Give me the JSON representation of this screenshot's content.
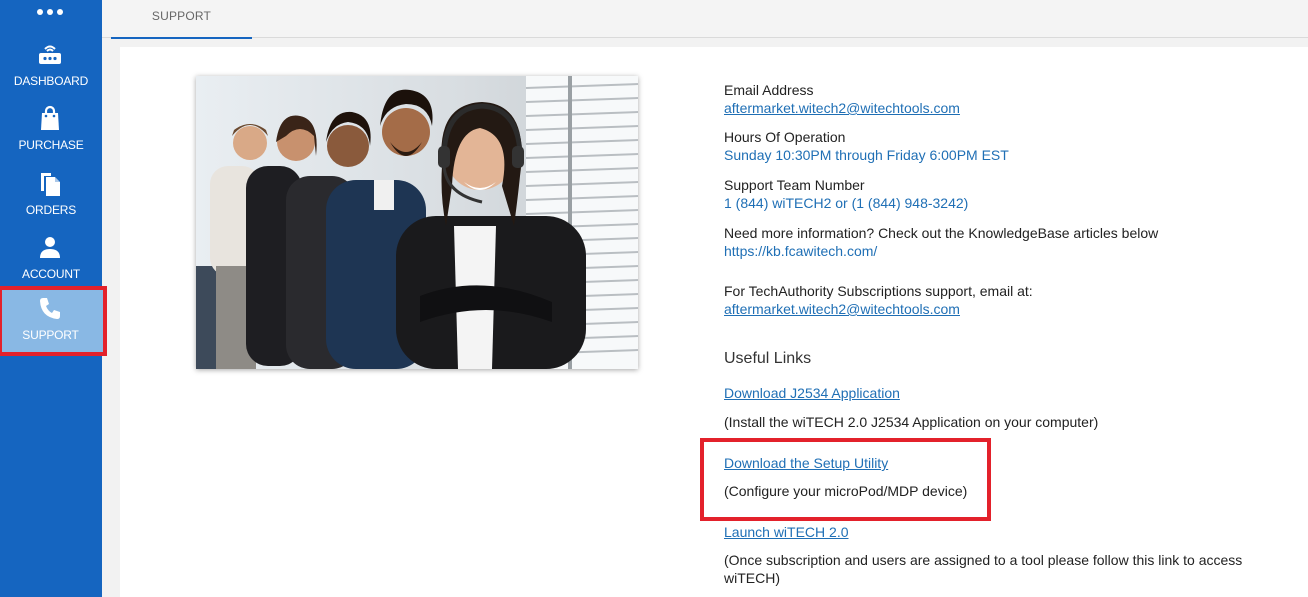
{
  "sidebar": {
    "items": [
      {
        "label": "DASHBOARD",
        "icon": "dashboard-icon"
      },
      {
        "label": "PURCHASE",
        "icon": "shopping-bag-icon"
      },
      {
        "label": "ORDERS",
        "icon": "documents-icon"
      },
      {
        "label": "ACCOUNT",
        "icon": "person-icon"
      },
      {
        "label": "SUPPORT",
        "icon": "phone-icon"
      }
    ],
    "active": "SUPPORT"
  },
  "tabs": [
    {
      "label": "SUPPORT"
    }
  ],
  "support": {
    "email_label": "Email Address",
    "email_value": "aftermarket.witech2@witechtools.com",
    "hours_label": "Hours Of Operation",
    "hours_value": "Sunday 10:30PM through Friday 6:00PM EST",
    "team_label": "Support Team Number",
    "team_value": "1 (844) wiTECH2 or (1 (844) 948-3242)",
    "kb_text": "Need more information? Check out the KnowledgeBase articles below",
    "kb_link": "https://kb.fcawitech.com/",
    "ta_text": "For TechAuthority Subscriptions support, email at:",
    "ta_email": "aftermarket.witech2@witechtools.com",
    "useful_links_heading": "Useful Links",
    "links": [
      {
        "label": "Download J2534 Application",
        "description": "(Install the wiTECH 2.0 J2534 Application on your computer)"
      },
      {
        "label": "Download the Setup Utility",
        "description": "(Configure your microPod/MDP device)"
      },
      {
        "label": "Launch wiTECH 2.0",
        "description_line1": "(Once subscription and users are assigned to a tool please follow this link to access",
        "description_line2": "wiTECH)"
      }
    ]
  },
  "colors": {
    "sidebar": "#1565c0",
    "active_item": "#89b8e4",
    "highlight": "#e3212b",
    "link": "#1f6fb5"
  }
}
